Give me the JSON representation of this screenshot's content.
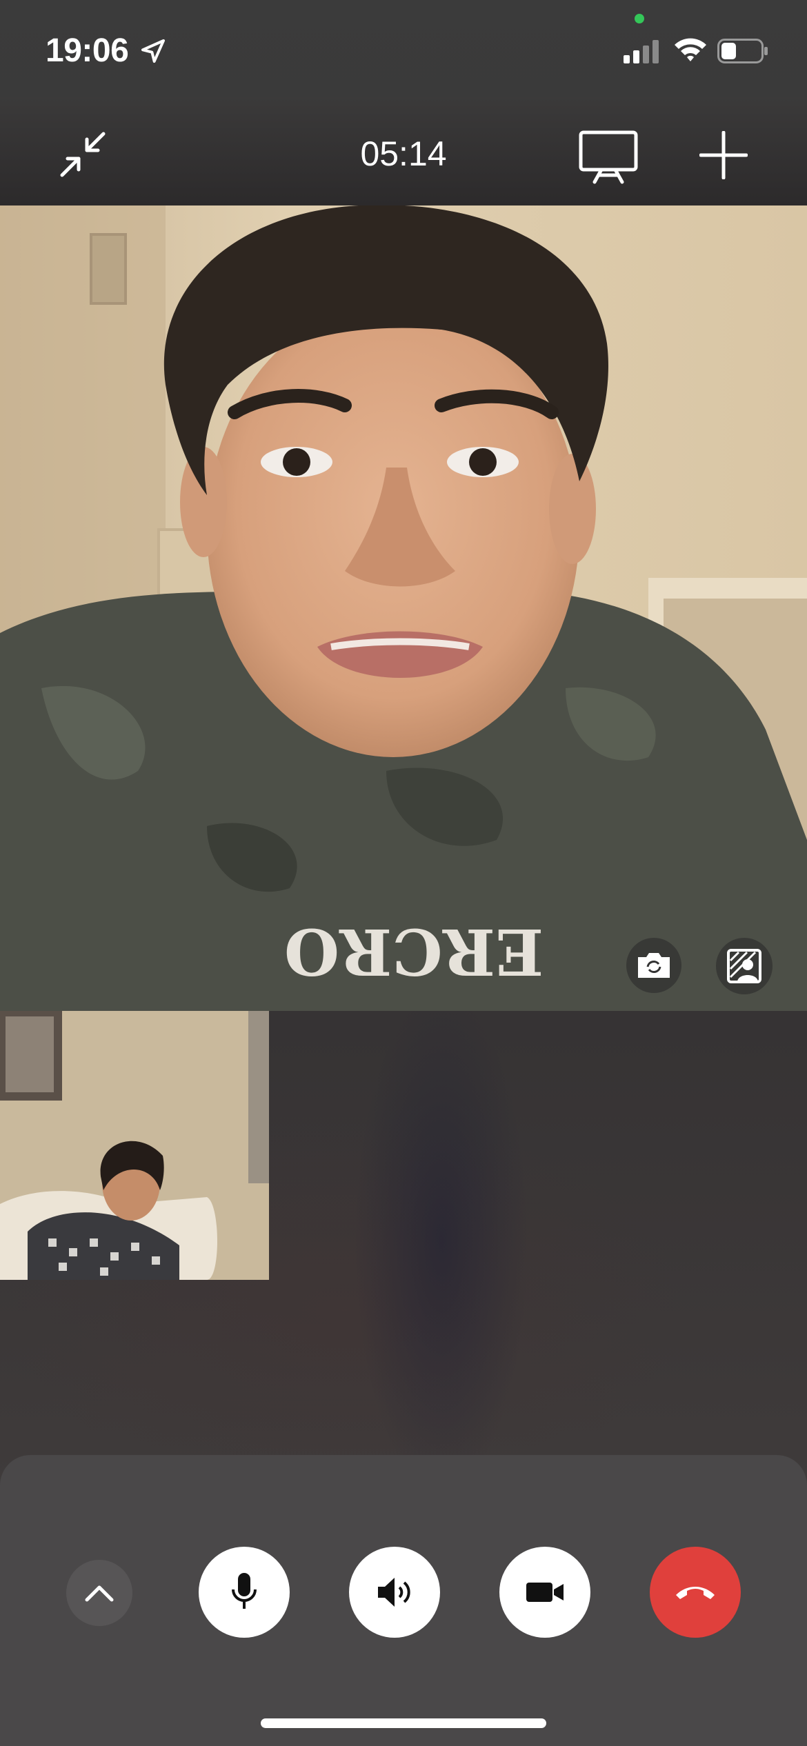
{
  "status_bar": {
    "time": "19:06",
    "location_icon": "location-arrow-icon",
    "signal_icon": "cellular-signal-icon",
    "wifi_icon": "wifi-icon",
    "battery_icon": "battery-icon",
    "battery_level": 0.35,
    "privacy_indicator_color": "#34c759"
  },
  "call_bar": {
    "minimize_icon": "minimize-arrows-icon",
    "duration": "05:14",
    "shareplay_icon": "screen-share-icon",
    "add_icon": "plus-icon"
  },
  "remote_video": {
    "shirt_text": "ERCRO",
    "flip_camera_icon": "camera-flip-icon",
    "portrait_icon": "portrait-mode-icon"
  },
  "self_view": {},
  "controls": {
    "expand_icon": "chevron-up-icon",
    "mute_icon": "microphone-icon",
    "speaker_icon": "speaker-icon",
    "camera_icon": "video-camera-icon",
    "end_call_icon": "end-call-icon",
    "end_call_color": "#e0403c"
  }
}
